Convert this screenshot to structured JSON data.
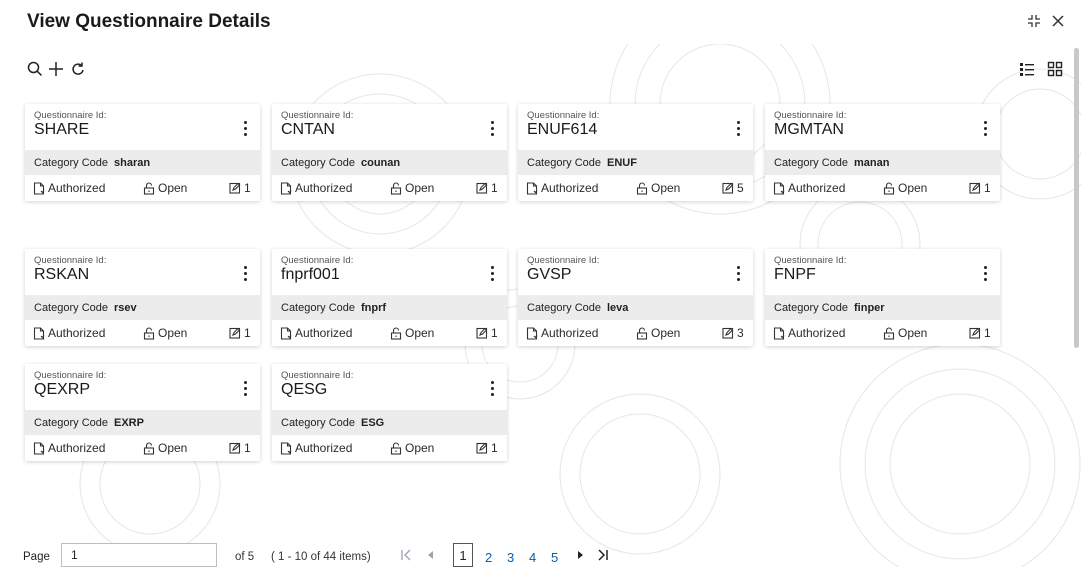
{
  "header": {
    "title": "View Questionnaire Details"
  },
  "cards": [
    {
      "label": "Questionnaire Id:",
      "id": "SHARE",
      "cc_label": "Category Code",
      "cc": "sharan",
      "status": "Authorized",
      "lock": "Open",
      "count": "1"
    },
    {
      "label": "Questionnaire Id:",
      "id": "CNTAN",
      "cc_label": "Category Code",
      "cc": "counan",
      "status": "Authorized",
      "lock": "Open",
      "count": "1"
    },
    {
      "label": "Questionnaire Id:",
      "id": "ENUF614",
      "cc_label": "Category Code",
      "cc": "ENUF",
      "status": "Authorized",
      "lock": "Open",
      "count": "5"
    },
    {
      "label": "Questionnaire Id:",
      "id": "MGMTAN",
      "cc_label": "Category Code",
      "cc": "manan",
      "status": "Authorized",
      "lock": "Open",
      "count": "1"
    },
    {
      "label": "Questionnaire Id:",
      "id": "RSKAN",
      "cc_label": "Category Code",
      "cc": "rsev",
      "status": "Authorized",
      "lock": "Open",
      "count": "1"
    },
    {
      "label": "Questionnaire Id:",
      "id": "fnprf001",
      "cc_label": "Category Code",
      "cc": "fnprf",
      "status": "Authorized",
      "lock": "Open",
      "count": "1"
    },
    {
      "label": "Questionnaire Id:",
      "id": "GVSP",
      "cc_label": "Category Code",
      "cc": "leva",
      "status": "Authorized",
      "lock": "Open",
      "count": "3"
    },
    {
      "label": "Questionnaire Id:",
      "id": "FNPF",
      "cc_label": "Category Code",
      "cc": "finper",
      "status": "Authorized",
      "lock": "Open",
      "count": "1"
    },
    {
      "label": "Questionnaire Id:",
      "id": "QEXRP",
      "cc_label": "Category Code",
      "cc": "EXRP",
      "status": "Authorized",
      "lock": "Open",
      "count": "1"
    },
    {
      "label": "Questionnaire Id:",
      "id": "QESG",
      "cc_label": "Category Code",
      "cc": "ESG",
      "status": "Authorized",
      "lock": "Open",
      "count": "1"
    }
  ],
  "pager": {
    "label": "Page",
    "current_value": "1",
    "of_text": "of 5",
    "items_text": "( 1 - 10 of 44 items)",
    "pages": [
      "1",
      "2",
      "3",
      "4",
      "5"
    ]
  },
  "colors": {
    "link": "#0a5ea8",
    "card_band": "#ececec"
  },
  "icons": [
    "search-icon",
    "add-icon",
    "refresh-icon",
    "list-view-icon",
    "grid-view-icon",
    "minimize-icon",
    "close-icon",
    "document-icon",
    "unlock-icon",
    "edit-icon",
    "kebab-icon"
  ]
}
